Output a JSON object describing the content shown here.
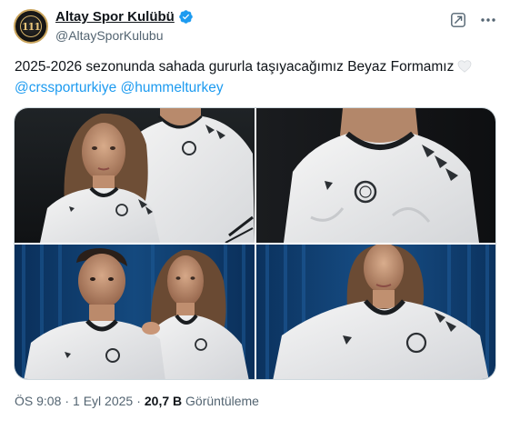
{
  "account": {
    "display_name": "Altay Spor Kulübü",
    "handle": "@AltaySporKulubu",
    "avatar_text": "111",
    "verified_color": "#1d9bf0"
  },
  "tweet": {
    "text": "2025-2026 sezonunda sahada gururla taşıyacağımız Beyaz Formamız",
    "mentions": [
      "@crssporturkiye",
      "@hummelturkey"
    ],
    "emoji": "white-heart-icon"
  },
  "media": {
    "photos": [
      "photo-couple-left",
      "photo-male-chest",
      "photo-couple-blue",
      "photo-female-blue"
    ]
  },
  "meta": {
    "time": "ÖS 9:08",
    "date": "1 Eyl 2025",
    "views_count": "20,7 B",
    "views_label": "Görüntüleme"
  },
  "colors": {
    "accent": "#1d9bf0",
    "text": "#0f1419",
    "secondary_text": "#536471",
    "border": "#cfd9de"
  }
}
